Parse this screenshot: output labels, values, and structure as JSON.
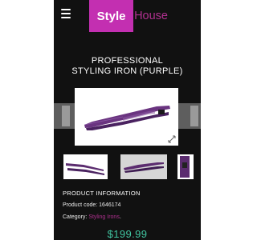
{
  "header": {
    "logo_style": "Style",
    "logo_house": "House",
    "menu_icon": "hamburger-menu-icon"
  },
  "product": {
    "title_line1": "PROFESSIONAL",
    "title_line2": "STYLING IRON (PURPLE)",
    "info_heading": "PRODUCT INFORMATION",
    "code_label": "Product code:",
    "code_value": "1646174",
    "category_label": "Category:",
    "category_value": "Styling Irons",
    "category_suffix": ".",
    "price": "$199.99"
  },
  "gallery": {
    "zoom_icon": "expand-icon",
    "thumbnail_count": 3
  },
  "colors": {
    "page_bg": "#111111",
    "brand_magenta": "#c32fb1",
    "price_teal": "#40c4a0",
    "product_purple": "#5b2c6f"
  }
}
